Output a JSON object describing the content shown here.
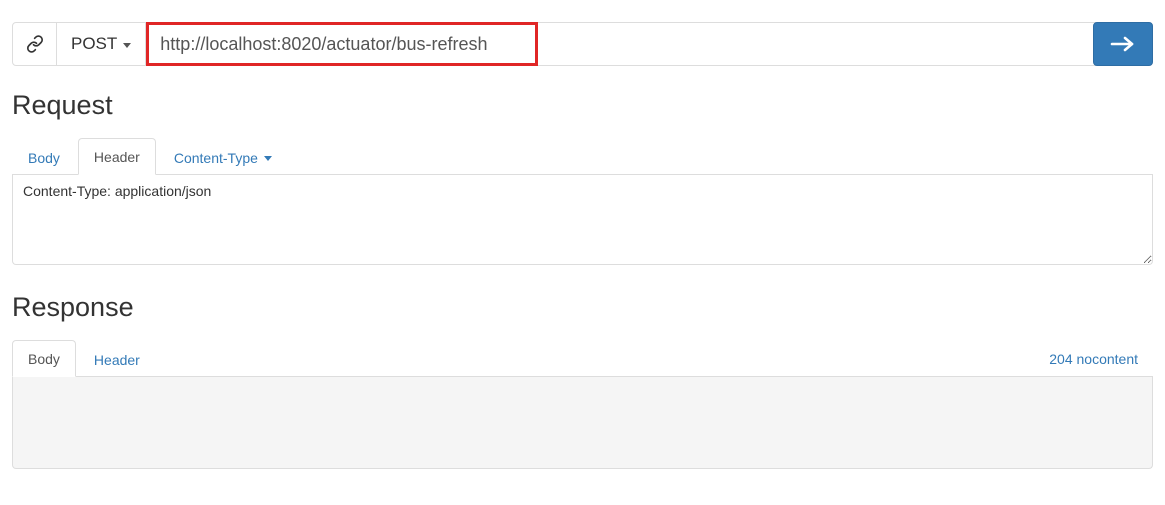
{
  "topbar": {
    "method": "POST",
    "url": "http://localhost:8020/actuator/bus-refresh"
  },
  "request": {
    "title": "Request",
    "tabs": {
      "body": "Body",
      "header": "Header",
      "content_type": "Content-Type"
    },
    "header_text": "Content-Type: application/json"
  },
  "response": {
    "title": "Response",
    "tabs": {
      "body": "Body",
      "header": "Header"
    },
    "status_text": "204 nocontent"
  }
}
